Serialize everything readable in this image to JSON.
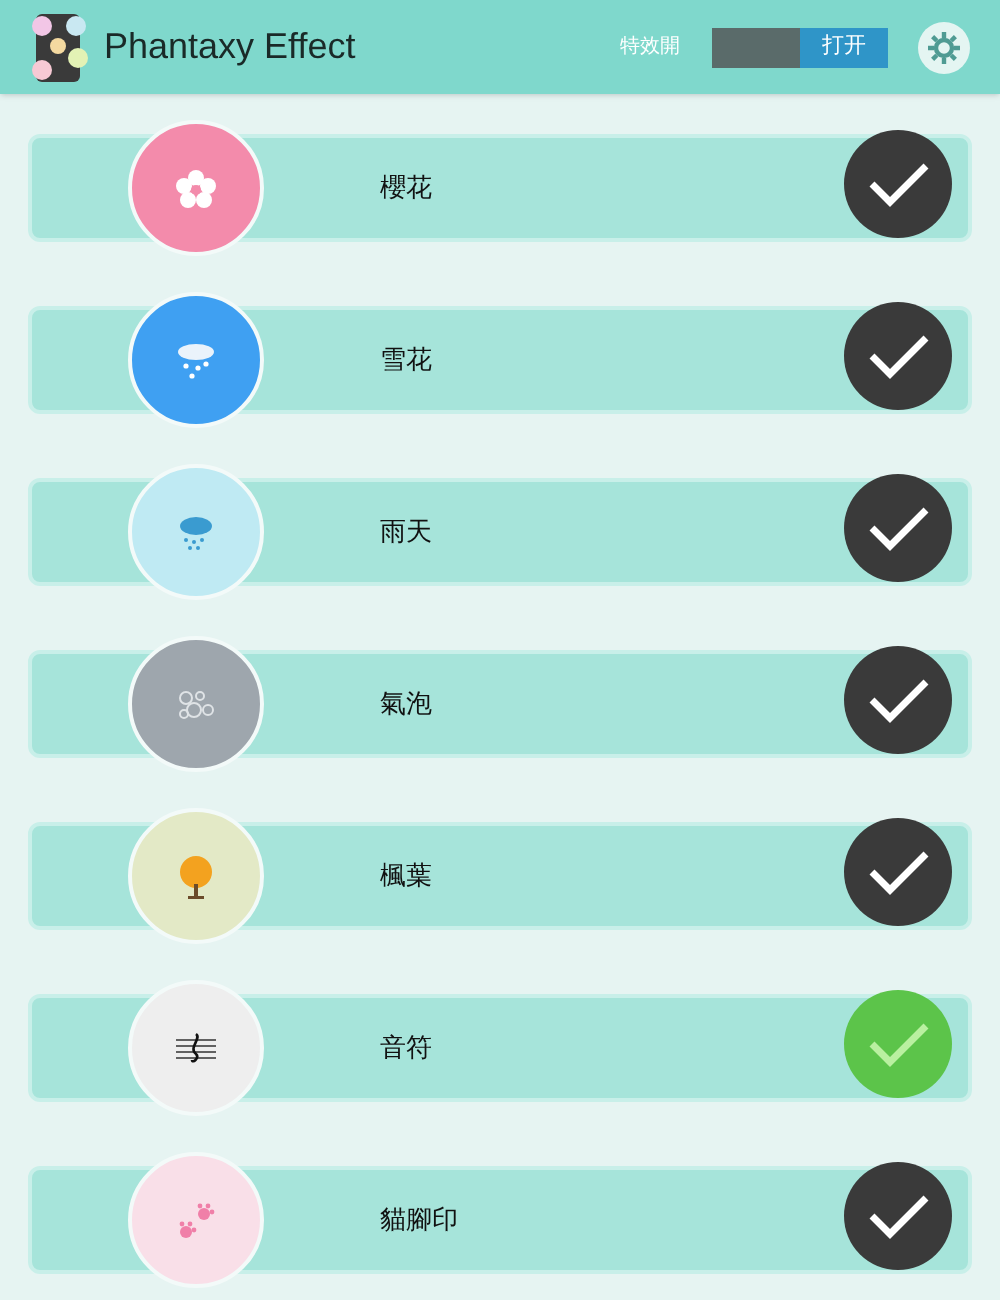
{
  "app_bar": {
    "title": "Phantaxy Effect",
    "toggle": {
      "label": "特效開",
      "state_label": "打开",
      "on": true
    }
  },
  "effects": [
    {
      "label": "櫻花",
      "color": "#f38bab",
      "selected": false
    },
    {
      "label": "雪花",
      "color": "#3fa0f2",
      "selected": false
    },
    {
      "label": "雨天",
      "color": "#bfeaf3",
      "selected": false
    },
    {
      "label": "氣泡",
      "color": "#9ea6ad",
      "selected": false
    },
    {
      "label": "楓葉",
      "color": "#e3e9c6",
      "selected": false
    },
    {
      "label": "音符",
      "color": "#eeeeee",
      "selected": true
    },
    {
      "label": "貓腳印",
      "color": "#f9dfe8",
      "selected": false
    }
  ]
}
